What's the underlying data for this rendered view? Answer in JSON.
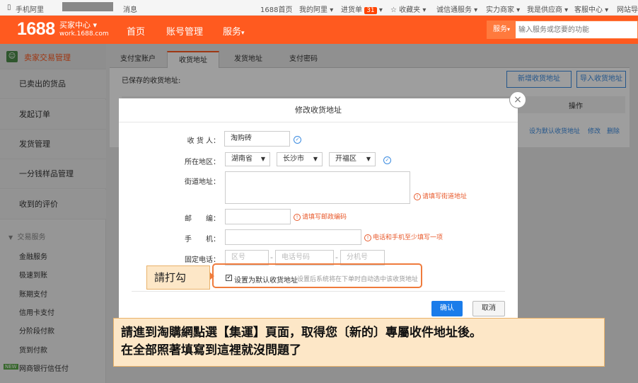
{
  "topbar": {
    "site": "手机阿里",
    "news": "消息",
    "links": [
      "1688首页",
      "我的阿里",
      "进货单",
      "收藏夹",
      "诚信通服务",
      "实力商家",
      "我是供应商",
      "客服中心",
      "网站导航"
    ],
    "cart_count": "31"
  },
  "header": {
    "logo": "1688",
    "logo_title": "买家中心",
    "logo_domain": "work.1688.com",
    "nav": [
      "首页",
      "账号管理",
      "服务"
    ],
    "search_scope": "服务",
    "search_placeholder": "输入服务或您要的功能"
  },
  "sidebar": {
    "title": "卖家交易管理",
    "items": [
      "已卖出的货品",
      "发起订单",
      "发货管理",
      "一分钱样品管理",
      "收到的评价"
    ],
    "section": "交易服务",
    "sub_items": [
      "金融服务",
      "极速到账",
      "账期支付",
      "信用卡支付",
      "分阶段付款",
      "货到付款",
      "网商银行信任付"
    ],
    "new_badge": "NEW"
  },
  "main": {
    "tabs": [
      "支付宝账户",
      "收货地址",
      "发货地址",
      "支付密码"
    ],
    "saved_label": "已保存的收货地址:",
    "new_button": "新增收货地址",
    "import_button": "导入收货地址",
    "col_ops": "操作",
    "row_ops": [
      "设为默认收货地址",
      "修改",
      "删除"
    ]
  },
  "modal": {
    "title": "修改收货地址",
    "receiver_label": "收 货 人：",
    "receiver_value": "淘购砖",
    "region_label": "所在地区：",
    "province": "湖南省",
    "city": "长沙市",
    "district": "开福区",
    "street_label": "街道地址：",
    "street_hint": "请填写街道地址",
    "zip_label": "邮　　编：",
    "zip_hint": "请填写邮政编码",
    "mobile_label": "手　　机：",
    "mobile_hint": "电话和手机至少填写一项",
    "phone_label": "固定电话：",
    "phone_area": "区号",
    "phone_number": "电话号码",
    "phone_ext": "分机号",
    "default_label": "设置为默认收货地址",
    "default_desc": "设置后系统将在下单时自动选中该收货地址",
    "confirm": "确认",
    "cancel": "取消"
  },
  "annotation": {
    "check_hint": "請打勾",
    "note_line1": "請進到淘購網點選【集運】頁面，取得您〔新的〕專屬收件地址後。",
    "note_line2": "在全部照著填寫到這裡就沒問題了"
  },
  "colors": {
    "brand_orange": "#ff5a1f",
    "primary_blue": "#1a7cea",
    "hint_orange": "#e8592b",
    "note_bg": "#fde7c7"
  }
}
